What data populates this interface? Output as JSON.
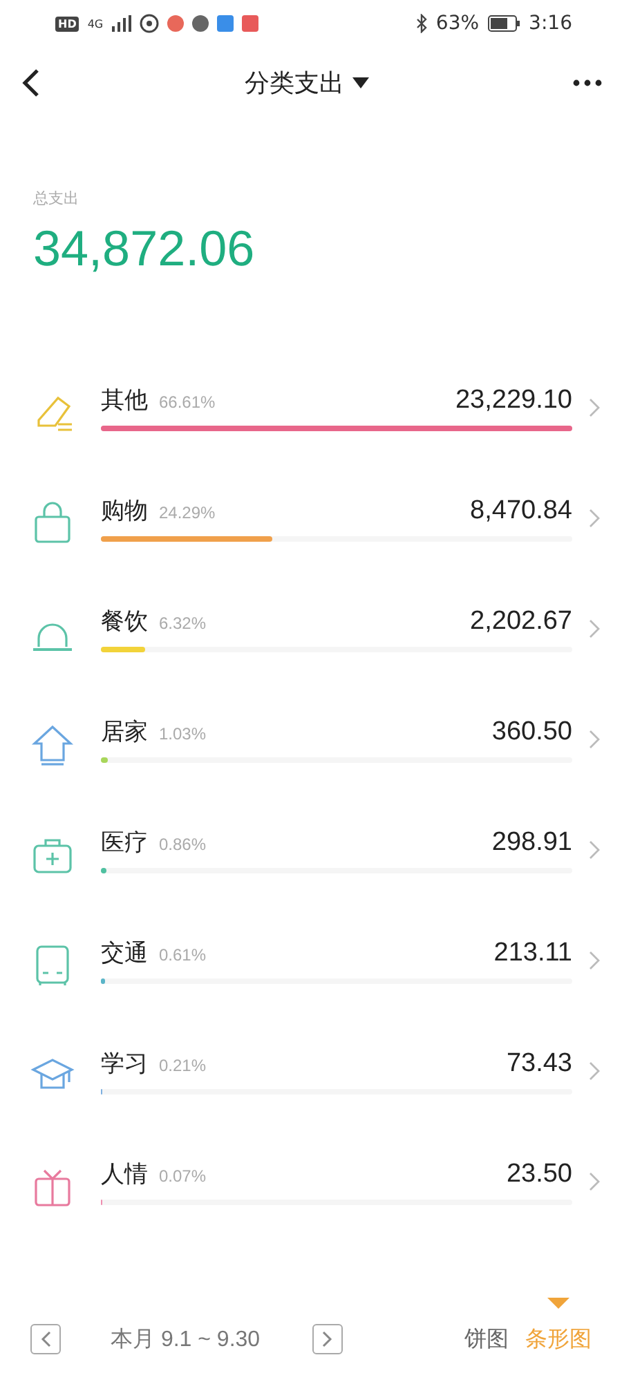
{
  "status_bar": {
    "hd": "HD",
    "network": "4G",
    "battery": "63%",
    "time": "3:16"
  },
  "header": {
    "title": "分类支出"
  },
  "summary": {
    "label": "总支出",
    "total": "34,872.06"
  },
  "categories": [
    {
      "kind": "pencil",
      "name": "其他",
      "share": "66.61%",
      "amount": "23,229.10",
      "level": 1,
      "color": "#e8668a"
    },
    {
      "kind": "bag",
      "name": "购物",
      "share": "24.29%",
      "amount": "8,470.84",
      "level": 0.365,
      "color": "#f0a04b"
    },
    {
      "kind": "dome",
      "name": "餐饮",
      "share": "6.32%",
      "amount": "2,202.67",
      "level": 0.095,
      "color": "#f2d33a"
    },
    {
      "kind": "house",
      "name": "居家",
      "share": "1.03%",
      "amount": "360.50",
      "level": 0.015,
      "color": "#a8d65a"
    },
    {
      "kind": "medkit",
      "name": "医疗",
      "share": "0.86%",
      "amount": "298.91",
      "level": 0.013,
      "color": "#4fc0a0"
    },
    {
      "kind": "bus",
      "name": "交通",
      "share": "0.61%",
      "amount": "213.11",
      "level": 0.009,
      "color": "#5ab5c8"
    },
    {
      "kind": "cap",
      "name": "学习",
      "share": "0.21%",
      "amount": "73.43",
      "level": 0.003,
      "color": "#7fb0e0"
    },
    {
      "kind": "gift",
      "name": "人情",
      "share": "0.07%",
      "amount": "23.50",
      "level": 0.001,
      "color": "#ee8fb0"
    }
  ],
  "footer": {
    "period": "本月 9.1 ~ 9.30",
    "views": [
      {
        "label": "饼图",
        "selected": false
      },
      {
        "label": "条形图",
        "selected": true
      }
    ]
  }
}
